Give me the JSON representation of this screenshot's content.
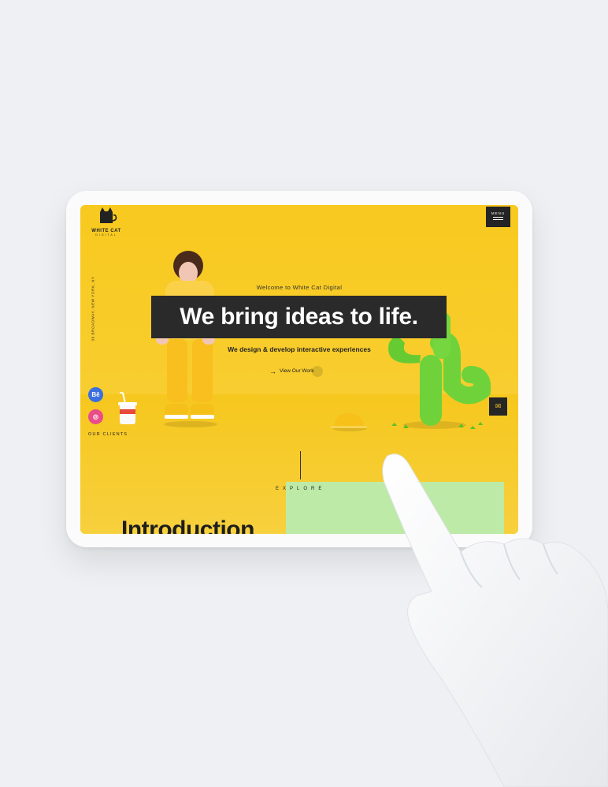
{
  "brand": {
    "name": "WHITE CAT",
    "subtitle": "DIGITAL"
  },
  "menu": {
    "label": "MENU"
  },
  "address": "36 BROADWAY, NEW YORK, NY",
  "hero": {
    "welcome": "Welcome to White Cat Digital",
    "headline": "We bring ideas to life.",
    "tagline": "We design & develop interactive experiences",
    "cta_label": "View Our Work"
  },
  "social": {
    "behance": "Bē",
    "dribbble": "◎"
  },
  "clients_label": "OUR CLIENTS",
  "explore_label": "EXPLORE",
  "intro_heading": "Introduction",
  "colors": {
    "background": "#eef0f3",
    "screen_yellow": "#f8c91f",
    "dark": "#2a2a2a",
    "cactus_green": "#6fd23a",
    "panel_green": "#bdeaa7"
  },
  "icons": {
    "logo": "cat-icon",
    "menu": "hamburger-icon",
    "cta": "arrow-right-icon",
    "mail": "mail-icon",
    "behance": "behance-icon",
    "dribbble": "dribbble-icon"
  }
}
